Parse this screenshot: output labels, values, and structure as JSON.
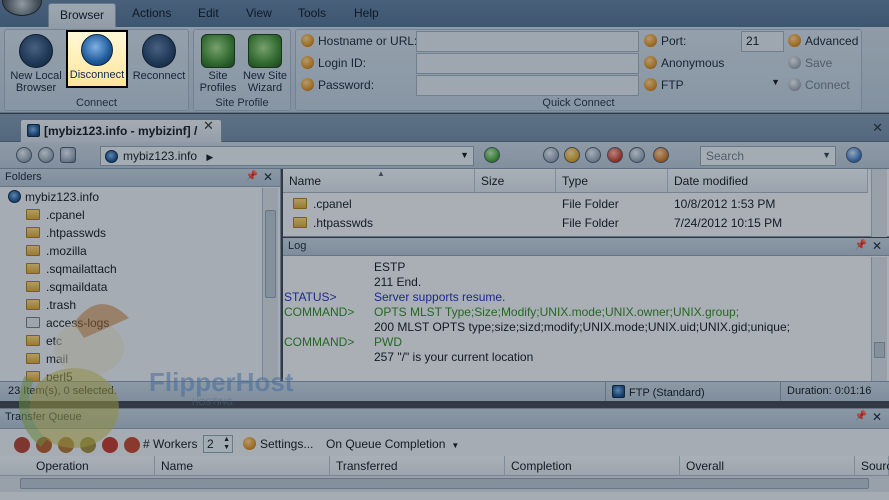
{
  "menu": {
    "items": [
      "Browser",
      "Actions",
      "Edit",
      "View",
      "Tools",
      "Help"
    ]
  },
  "ribbon": {
    "connect_group": {
      "caption": "Connect",
      "new_local_browser": "New Local Browser",
      "disconnect": "Disconnect",
      "reconnect": "Reconnect"
    },
    "site_profile_group": {
      "caption": "Site Profile",
      "site_profiles": "Site Profiles",
      "new_site_wizard": "New Site Wizard"
    },
    "quick_connect": {
      "caption": "Quick Connect",
      "hostname_label": "Hostname or URL:",
      "login_label": "Login ID:",
      "password_label": "Password:",
      "hostname_value": "",
      "login_value": "",
      "password_value": "",
      "port_label": "Port:",
      "port_value": "21",
      "anonymous_label": "Anonymous",
      "protocol_label": "FTP",
      "advanced_label": "Advanced",
      "save_label": "Save",
      "connect_label": "Connect"
    }
  },
  "tab": {
    "title": "[mybiz123.info - mybizinf] /",
    "close": "✕"
  },
  "address": {
    "path": "mybiz123.info",
    "search_placeholder": "Search"
  },
  "folders": {
    "title": "Folders",
    "root": "mybiz123.info",
    "items": [
      ".cpanel",
      ".htpasswds",
      ".mozilla",
      ".sqmailattach",
      ".sqmaildata",
      ".trash",
      "access-logs",
      "etc",
      "mail",
      "perl5"
    ]
  },
  "filelist": {
    "columns": [
      "Name",
      "Size",
      "Type",
      "Date modified"
    ],
    "rows": [
      {
        "name": ".cpanel",
        "size": "",
        "type": "File Folder",
        "date": "10/8/2012 1:53 PM"
      },
      {
        "name": ".htpasswds",
        "size": "",
        "type": "File Folder",
        "date": "7/24/2012 10:15 PM"
      }
    ]
  },
  "log": {
    "title": "Log",
    "lines": [
      {
        "prefix": "",
        "text": "ESTP",
        "kind": "plain"
      },
      {
        "prefix": "",
        "text": "211 End.",
        "kind": "plain"
      },
      {
        "prefix": "STATUS>",
        "text": "Server supports resume.",
        "kind": "status"
      },
      {
        "prefix": "COMMAND>",
        "text": "OPTS MLST Type;Size;Modify;UNIX.mode;UNIX.owner;UNIX.group;",
        "kind": "command"
      },
      {
        "prefix": "",
        "text": "200  MLST OPTS type;size;sizd;modify;UNIX.mode;UNIX.uid;UNIX.gid;unique;",
        "kind": "plain"
      },
      {
        "prefix": "COMMAND>",
        "text": "PWD",
        "kind": "command"
      },
      {
        "prefix": "",
        "text": "257 \"/\" is your current location",
        "kind": "plain"
      }
    ]
  },
  "status": {
    "items_selected": "23 Item(s), 0 selected.",
    "protocol": "FTP (Standard)",
    "duration": "Duration: 0:01:16"
  },
  "queue": {
    "title": "Transfer Queue",
    "workers_label": "# Workers",
    "workers_value": "2",
    "settings_label": "Settings...",
    "completion_label": "On Queue Completion",
    "columns": [
      "Operation",
      "Name",
      "Transferred",
      "Completion",
      "Overall",
      "Sourc"
    ]
  },
  "watermark": {
    "brand": "FlipperHost",
    "tagline": "HOSTING"
  }
}
